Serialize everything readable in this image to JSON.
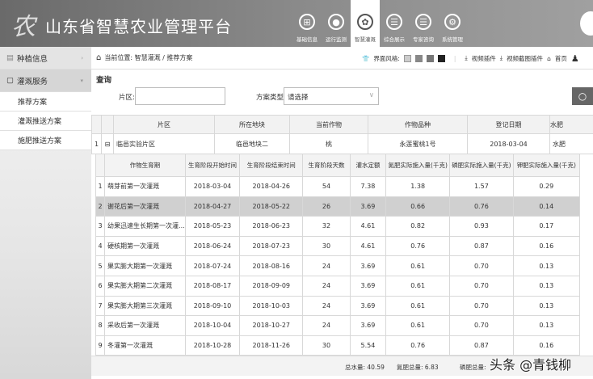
{
  "app": {
    "title": "山东省智慧农业管理平台",
    "logo_text": "农"
  },
  "nav": [
    {
      "label": "基础信息",
      "icon": "grid-circle-icon",
      "glyph": "⊞"
    },
    {
      "label": "运行监测",
      "icon": "location-pin-icon",
      "glyph": "●"
    },
    {
      "label": "智慧灌溉",
      "icon": "flower-icon",
      "glyph": "✿"
    },
    {
      "label": "综合展示",
      "icon": "clipboard-icon",
      "glyph": "☰"
    },
    {
      "label": "专家咨询",
      "icon": "clipboard-icon",
      "glyph": "☰"
    },
    {
      "label": "系统管理",
      "icon": "gear-icon",
      "glyph": "⚙"
    }
  ],
  "sidebar": {
    "groups": [
      {
        "label": "种植信息"
      },
      {
        "label": "灌溉服务"
      }
    ],
    "items": [
      {
        "label": "推荐方案"
      },
      {
        "label": "灌溉推送方案"
      },
      {
        "label": "施肥推送方案"
      }
    ]
  },
  "breadcrumb": {
    "prefix": "当前位置:",
    "path": "智慧灌溉 / 推荐方案",
    "theme_label": "界面风格:",
    "video_plugin": "视频插件",
    "video_capture_plugin": "视频截图插件",
    "home": "首页"
  },
  "query": {
    "title": "查询",
    "area_label": "片区:",
    "area_value": "",
    "type_label": "方案类型:",
    "type_value": "请选择"
  },
  "parent_table": {
    "headers": [
      "片区",
      "所在地块",
      "当前作物",
      "作物品种",
      "登记日期",
      "水肥"
    ],
    "row": {
      "index": "1",
      "toggle": "⊟",
      "area": "临邑实验片区",
      "plot": "临邑地块二",
      "crop": "桃",
      "variety": "永莲蜜桃1号",
      "date": "2018-03-04",
      "extra": "水肥"
    }
  },
  "child_table": {
    "headers": [
      "作物生育期",
      "生育阶段开始时间",
      "生育阶段结束时间",
      "生育阶段天数",
      "灌水定额",
      "氮肥实际施入量(千克)",
      "磷肥实际施入量(千克)",
      "钾肥实际施入量(千克)"
    ],
    "rows": [
      [
        "1",
        "萌芽前第一次灌溉",
        "2018-03-04",
        "2018-04-26",
        "54",
        "7.38",
        "1.38",
        "1.57",
        "0.29"
      ],
      [
        "2",
        "谢花后第一次灌溉",
        "2018-04-27",
        "2018-05-22",
        "26",
        "3.69",
        "0.66",
        "0.76",
        "0.14"
      ],
      [
        "3",
        "幼果迅速生长期第一次灌...",
        "2018-05-23",
        "2018-06-23",
        "32",
        "4.61",
        "0.82",
        "0.93",
        "0.17"
      ],
      [
        "4",
        "硬核期第一次灌溉",
        "2018-06-24",
        "2018-07-23",
        "30",
        "4.61",
        "0.76",
        "0.87",
        "0.16"
      ],
      [
        "5",
        "果实膨大期第一次灌溉",
        "2018-07-24",
        "2018-08-16",
        "24",
        "3.69",
        "0.61",
        "0.70",
        "0.13"
      ],
      [
        "6",
        "果实膨大期第二次灌溉",
        "2018-08-17",
        "2018-09-09",
        "24",
        "3.69",
        "0.61",
        "0.70",
        "0.13"
      ],
      [
        "7",
        "果实膨大期第三次灌溉",
        "2018-09-10",
        "2018-10-03",
        "24",
        "3.69",
        "0.61",
        "0.70",
        "0.13"
      ],
      [
        "8",
        "采收后第一次灌溉",
        "2018-10-04",
        "2018-10-27",
        "24",
        "3.69",
        "0.61",
        "0.70",
        "0.13"
      ],
      [
        "9",
        "冬灌第一次灌溉",
        "2018-10-28",
        "2018-11-26",
        "30",
        "5.54",
        "0.76",
        "0.87",
        "0.16"
      ]
    ],
    "selected_row": 2
  },
  "footer": {
    "total_water": "总水量: 40.59",
    "total_n": "氮肥总量: 6.83",
    "total_p": "磷肥总量:"
  },
  "watermark": "头条 @青钱柳"
}
